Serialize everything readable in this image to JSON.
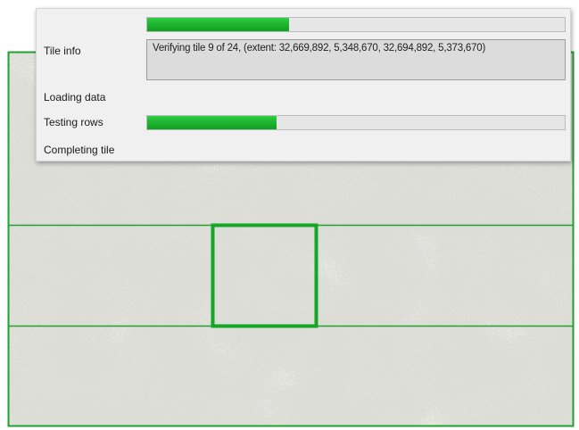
{
  "panel": {
    "top_progress": 0.34,
    "tile_info_label": "Tile info",
    "tile_info_text": "Verifying tile 9 of 24, (extent: 32,669,892, 5,348,670, 32,694,892, 5,373,670)",
    "loading_label": "Loading data",
    "testing_label": "Testing rows",
    "testing_progress": 0.31,
    "completing_label": "Completing tile"
  },
  "colors": {
    "progress_green": "#1fb532",
    "tile_outline": "#1fa12e",
    "map_base": "#b4b4ae",
    "map_light": "#e8e8e2"
  }
}
